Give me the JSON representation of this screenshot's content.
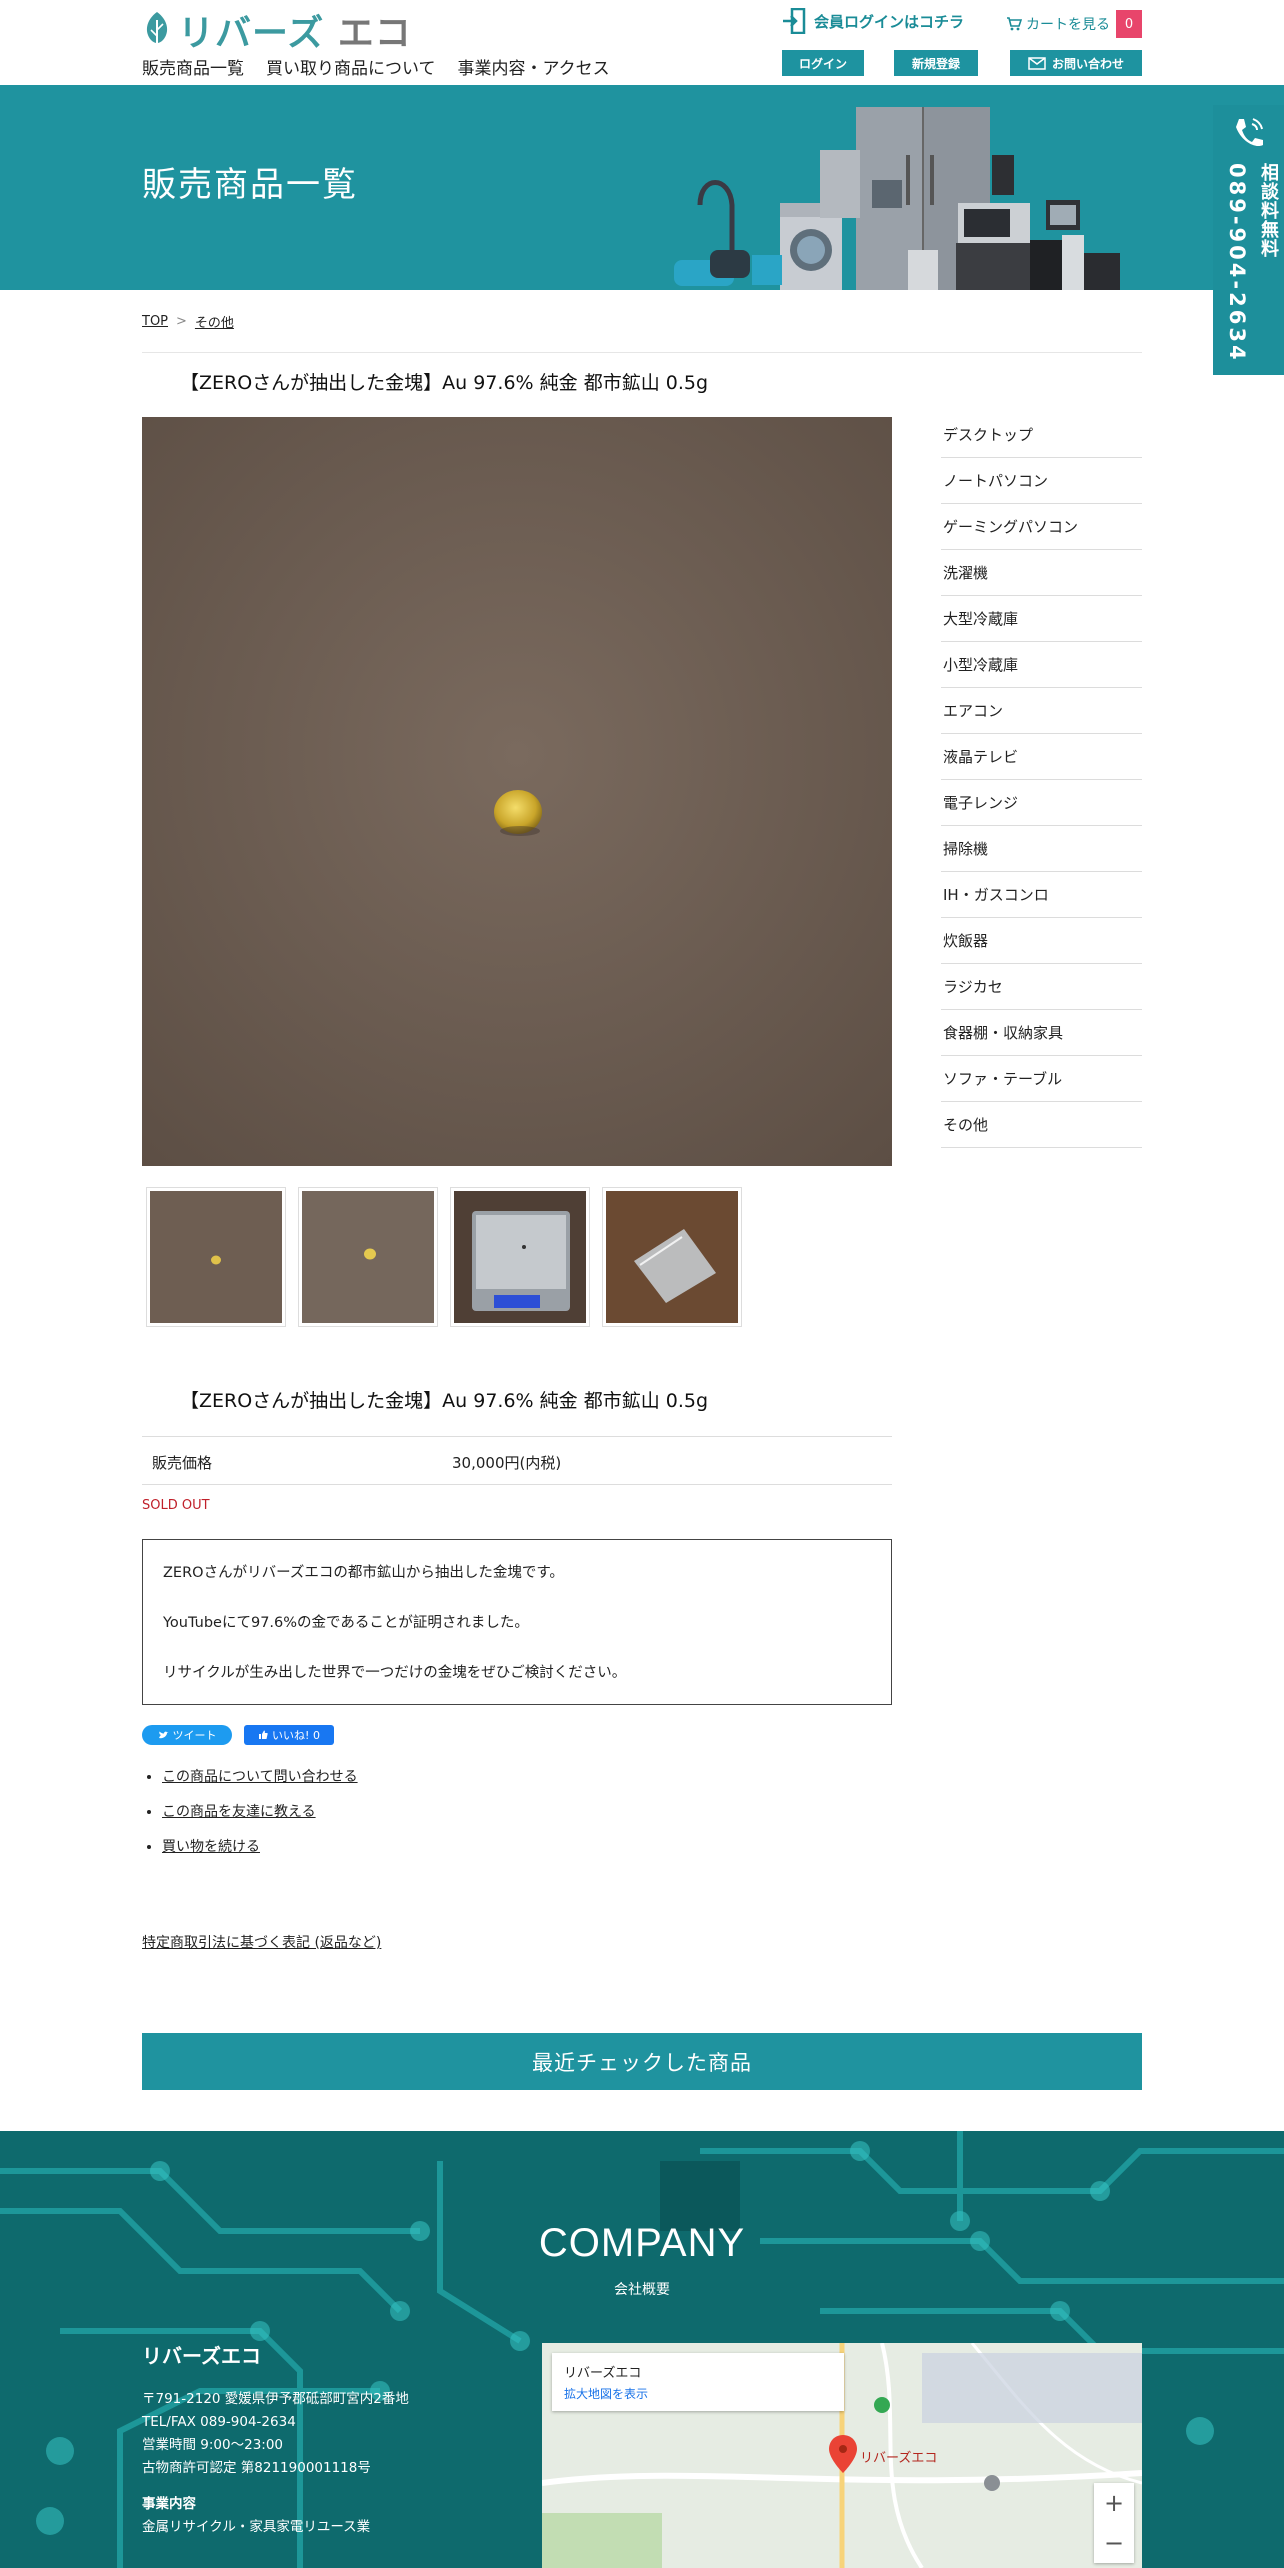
{
  "header": {
    "logo_text_teal": "リバーズ",
    "logo_text_gray": "エコ",
    "nav": [
      "販売商品一覧",
      "買い取り商品について",
      "事業内容・アクセス"
    ],
    "member_login": "会員ログインはコチラ",
    "cart_label": "カートを見る",
    "cart_count": "0",
    "login_btn": "ログイン",
    "register_btn": "新規登録",
    "contact_btn": "お問い合わせ"
  },
  "hero": {
    "title": "販売商品一覧"
  },
  "side_tab": {
    "line1": "相談料無料",
    "line2": "089-904-2634"
  },
  "breadcrumb": {
    "items": [
      "TOP",
      "その他"
    ],
    "separator": ">"
  },
  "product": {
    "title": "【ZEROさんが抽出した金塊】Au 97.6% 純金 都市鉱山 0.5g",
    "price_label": "販売価格",
    "price_value": "30,000円(内税)",
    "status": "SOLD OUT",
    "description": [
      "ZEROさんがリバーズエコの都市鉱山から抽出した金塊です。",
      "YouTubeにて97.6%の金であることが証明されました。",
      "リサイクルが生み出した世界で一つだけの金塊をぜひご検討ください。"
    ],
    "thumbnails": [
      "gold-nugget-far",
      "gold-nugget-close",
      "digital-scale",
      "plastic-bag"
    ]
  },
  "social": {
    "tweet": "ツイート",
    "like": "いいね! 0"
  },
  "links": [
    "この商品について問い合わせる",
    "この商品を友達に教える",
    "買い物を続ける"
  ],
  "tokutei": "特定商取引法に基づく表記 (返品など)",
  "recent": "最近チェックした商品",
  "sidebar": {
    "categories": [
      "デスクトップ",
      "ノートパソコン",
      "ゲーミングパソコン",
      "洗濯機",
      "大型冷蔵庫",
      "小型冷蔵庫",
      "エアコン",
      "液晶テレビ",
      "電子レンジ",
      "掃除機",
      "IH・ガスコンロ",
      "炊飯器",
      "ラジカセ",
      "食器棚・収納家具",
      "ソファ・テーブル",
      "その他"
    ]
  },
  "footer": {
    "heading": "COMPANY",
    "subheading": "会社概要",
    "company_name": "リバーズエコ",
    "address": "〒791-2120 愛媛県伊予郡砥部町宮内2番地",
    "tel": "TEL/FAX 089-904-2634",
    "hours": "営業時間 9:00〜23:00",
    "license": "古物商許可認定 第821190001118号",
    "biz_title": "事業内容",
    "biz_value": "金属リサイクル・家具家電リユース業",
    "map_name": "リバーズエコ",
    "map_link": "拡大地図を表示",
    "map_pin": "リバーズエコ",
    "zoom_in": "+",
    "zoom_out": "−"
  },
  "colors": {
    "brand": "#1f939f",
    "badge": "#e8456b",
    "soldout": "#c0202a"
  }
}
